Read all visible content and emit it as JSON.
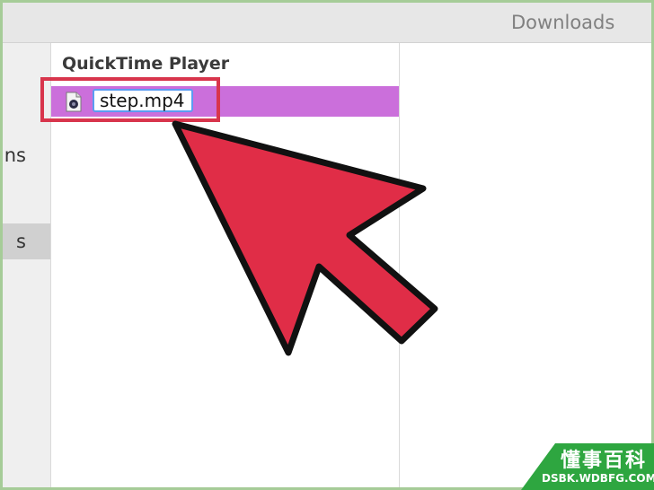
{
  "window": {
    "title": "Downloads"
  },
  "sidebar": {
    "items": [
      {
        "label": "ns",
        "selected": false
      },
      {
        "label": "s",
        "selected": true
      }
    ]
  },
  "column": {
    "header": "QuickTime Player",
    "file": {
      "name": "step.mp4",
      "icon": "movie-file-icon"
    }
  },
  "colors": {
    "selection_row": "#cb6fdb",
    "highlight": "#d8354c",
    "arrow": "#e02d47",
    "rename_border": "#5b9cf2",
    "watermark_bg": "#2ea640"
  },
  "watermark": {
    "cn": "懂事百科",
    "url": "DSBK.WDBFG.COM"
  }
}
